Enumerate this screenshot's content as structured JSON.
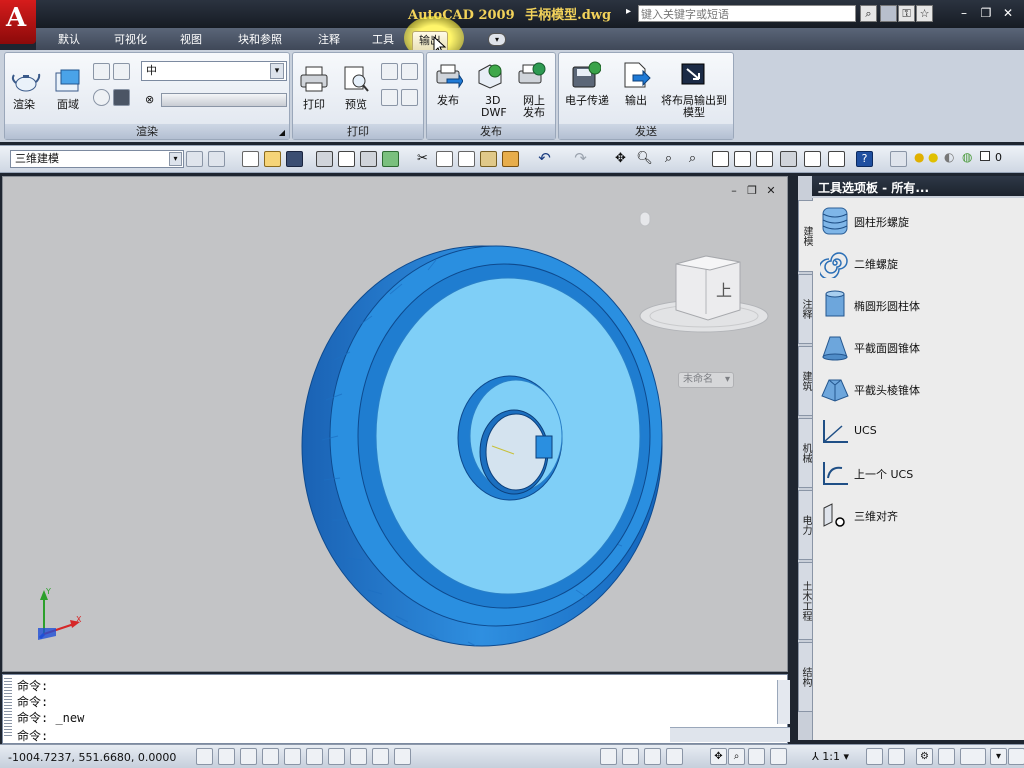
{
  "title": {
    "app_text": "AutoCAD 2009",
    "file_text": "手柄模型.dwg",
    "search_placeholder": "键入关键字或短语"
  },
  "ribbon_tabs": [
    {
      "label": "默认"
    },
    {
      "label": "可视化"
    },
    {
      "label": "视图"
    },
    {
      "label": "块和参照"
    },
    {
      "label": "注释"
    },
    {
      "label": "工具"
    },
    {
      "label": "输出",
      "active": true
    }
  ],
  "ribbon": {
    "render_panel": {
      "title": "渲染",
      "render_label": "渲染",
      "region_label": "面域",
      "quality_value": "中"
    },
    "plot_panel": {
      "title": "打印",
      "plot_label": "打印",
      "preview_label": "预览"
    },
    "publish_panel": {
      "title": "发布",
      "publish_label": "发布",
      "dwf_label_1": "3D",
      "dwf_label_2": "DWF",
      "web_label_1": "网上",
      "web_label_2": "发布"
    },
    "send_panel": {
      "title": "发送",
      "etransmit_label": "电子传递",
      "export_label": "输出",
      "layout_model_label_1": "将布局输出到",
      "layout_model_label_2": "模型"
    }
  },
  "toolbar": {
    "workspace_value": "三维建模",
    "layer_value": "0"
  },
  "viewport": {
    "named_view": "未命名",
    "viewcube_face": "上",
    "model_color": "#2a8fe0",
    "background_color": "#c3c4c6"
  },
  "palette": {
    "title": "工具选项板 - 所有...",
    "tabs": [
      {
        "label": "建模",
        "active": true
      },
      {
        "label": "注释"
      },
      {
        "label": "建筑"
      },
      {
        "label": "机械"
      },
      {
        "label": "电力"
      },
      {
        "label": "土木工程"
      },
      {
        "label": "结构"
      }
    ],
    "items": [
      {
        "label": "圆柱形螺旋",
        "icon": "helix-cylinder-icon"
      },
      {
        "label": "二维螺旋",
        "icon": "spiral-icon"
      },
      {
        "label": "椭圆形圆柱体",
        "icon": "elliptic-cylinder-icon"
      },
      {
        "label": "平截面圆锥体",
        "icon": "frustum-cone-icon"
      },
      {
        "label": "平截头棱锥体",
        "icon": "frustum-pyramid-icon"
      },
      {
        "label": "UCS",
        "icon": "ucs-icon"
      },
      {
        "label": "上一个 UCS",
        "icon": "ucs-previous-icon"
      },
      {
        "label": "三维对齐",
        "icon": "3d-align-icon"
      }
    ]
  },
  "command": {
    "lines": [
      "命令:",
      "命令:",
      "命令: _new"
    ],
    "prompt": "命令:"
  },
  "status": {
    "coords": "-1004.7237, 551.6680, 0.0000",
    "annotation_scale": "1:1"
  }
}
